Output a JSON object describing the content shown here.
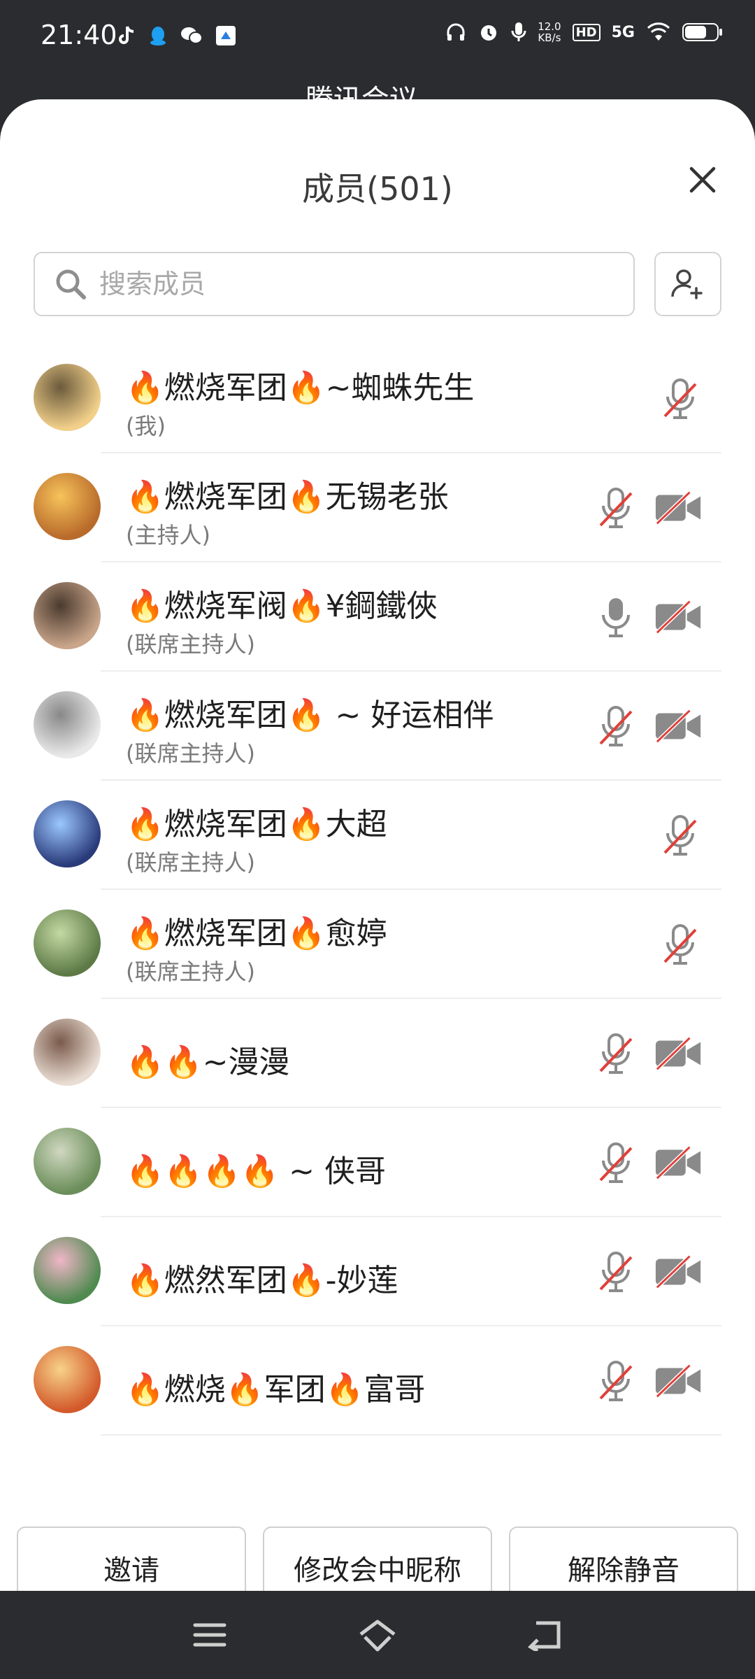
{
  "status_bar": {
    "time": "21:40",
    "network_speed": "12.0",
    "network_unit": "KB/s",
    "hd": "HD",
    "network_type": "5G",
    "icons": [
      "tiktok-icon",
      "qq-icon",
      "wechat-icon",
      "app-icon",
      "headphones-icon",
      "alarm-icon",
      "mic-icon",
      "wifi-icon",
      "battery-icon"
    ]
  },
  "background_header": {
    "title": "腾讯会议 ⌄"
  },
  "sheet": {
    "title": "成员(501)",
    "search_placeholder": "搜索成员"
  },
  "members": [
    {
      "name": "🔥燃烧军团🔥~蜘蛛先生",
      "role": "(我)",
      "mic": "muted",
      "camera": "none"
    },
    {
      "name": "🔥燃烧军团🔥无锡老张",
      "role": "(主持人)",
      "mic": "muted",
      "camera": "off"
    },
    {
      "name": "🔥燃烧军阀🔥¥鋼鐵俠",
      "role": "(联席主持人)",
      "mic": "on",
      "camera": "off"
    },
    {
      "name": "🔥燃烧军团🔥 ~ 好运相伴",
      "role": "(联席主持人)",
      "mic": "muted",
      "camera": "off"
    },
    {
      "name": "🔥燃烧军团🔥大超",
      "role": "(联席主持人)",
      "mic": "muted",
      "camera": "none"
    },
    {
      "name": "🔥燃烧军团🔥愈婷",
      "role": "(联席主持人)",
      "mic": "muted",
      "camera": "none"
    },
    {
      "name": "🔥🔥~漫漫",
      "role": "",
      "mic": "muted",
      "camera": "off"
    },
    {
      "name": "🔥🔥🔥🔥 ~ 侠哥",
      "role": "",
      "mic": "muted",
      "camera": "off"
    },
    {
      "name": "🔥燃然军团🔥-妙莲",
      "role": "",
      "mic": "muted",
      "camera": "off"
    },
    {
      "name": "🔥燃烧🔥军团🔥富哥",
      "role": "",
      "mic": "muted",
      "camera": "off"
    }
  ],
  "actions": {
    "invite": "邀请",
    "rename": "修改会中昵称",
    "unmute": "解除静音"
  },
  "colors": {
    "accent_red": "#e0403a",
    "icon_gray": "#8a8a8a",
    "fire": "#ff7a1a"
  }
}
